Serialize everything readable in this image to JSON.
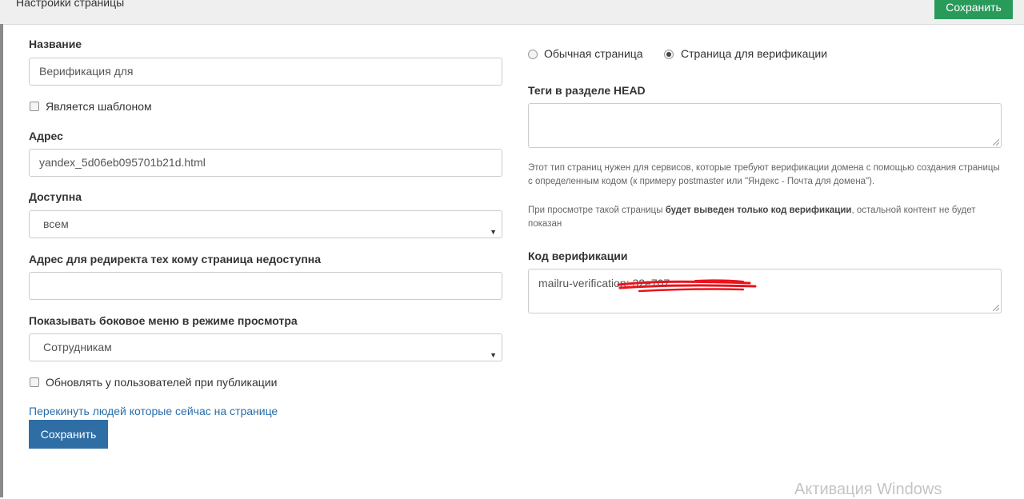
{
  "header": {
    "title": "Настройки страницы",
    "save_label": "Сохранить"
  },
  "left": {
    "name_label": "Название",
    "name_value": "Верификация для",
    "is_template_label": "Является шаблоном",
    "address_label": "Адрес",
    "address_value": "yandex_5d06eb095701b21d.html",
    "available_label": "Доступна",
    "available_value": "всем",
    "redirect_label": "Адрес для редиректа тех кому страница недоступна",
    "redirect_value": "",
    "sidebar_label": "Показывать боковое меню в режиме просмотра",
    "sidebar_value": "Сотрудникам",
    "update_label": "Обновлять у пользователей при публикации",
    "kick_link": "Перекинуть людей которые сейчас на странице",
    "save_label": "Сохранить"
  },
  "right": {
    "radio_normal": "Обычная страница",
    "radio_verification": "Страница для верификации",
    "head_tags_label": "Теги в разделе HEAD",
    "help_1": "Этот тип страниц нужен для сервисов, которые требуют верификации домена с помощью создания страницы с определенным кодом (к примеру postmaster или \"Яндекс - Почта для домена\").",
    "help_2_pre": "При просмотре такой страницы ",
    "help_2_bold": "будет выведен только код верификации",
    "help_2_post": ", остальной контент не будет показан",
    "code_label": "Код верификации",
    "code_value": "mailru-verification: 32e707"
  },
  "watermark": "Активация Windows",
  "colors": {
    "primary": "#2f6ea5",
    "success": "#2a9a5b",
    "link": "#2a6eaa",
    "redaction": "#e8141c"
  }
}
